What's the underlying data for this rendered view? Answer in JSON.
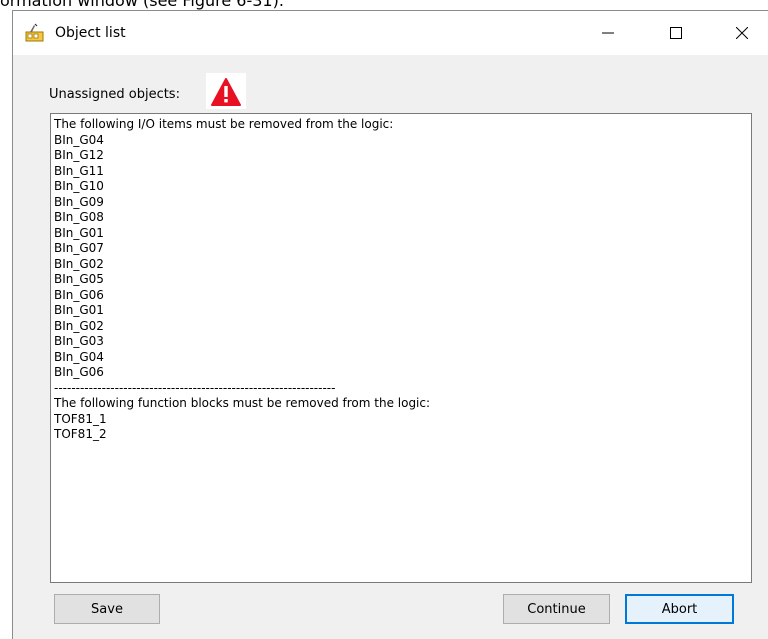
{
  "caption": "ormation window (see Figure 6-31).",
  "window": {
    "title": "Object list",
    "app_icon": "object-list-app-icon",
    "caption_buttons": {
      "minimize_icon": "minimize-icon",
      "maximize_icon": "maximize-icon",
      "close_icon": "close-icon"
    }
  },
  "unassigned": {
    "label": "Unassigned objects:",
    "warning_icon": "warning-icon",
    "warning_color": "#e81123"
  },
  "list": {
    "lines": [
      "The following I/O items must be removed from the logic:",
      "BIn_G04",
      "BIn_G12",
      "BIn_G11",
      "BIn_G10",
      "BIn_G09",
      "BIn_G08",
      "BIn_G01",
      "BIn_G07",
      "BIn_G02",
      "BIn_G05",
      "BIn_G06",
      "BIn_G01",
      "BIn_G02",
      "BIn_G03",
      "BIn_G04",
      "BIn_G06",
      "-----------------------------------------------------------------",
      "The following function blocks must be removed from the logic:",
      "TOF81_1",
      "TOF81_2"
    ]
  },
  "buttons": {
    "save": "Save",
    "continue": "Continue",
    "abort": "Abort"
  },
  "colors": {
    "accent": "#0078d7",
    "window_bg": "#f0f0f0"
  }
}
